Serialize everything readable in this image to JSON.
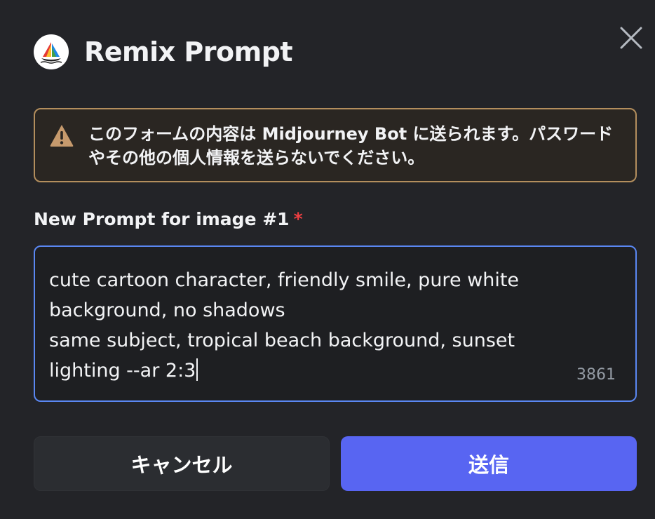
{
  "modal": {
    "title": "Remix Prompt",
    "close_icon": "close-icon",
    "avatar_icon": "midjourney-sailboat-icon"
  },
  "warning": {
    "icon": "warning-icon",
    "text": "このフォームの内容は Midjourney Bot に送られます。パスワードやその他の個人情報を送らないでください。"
  },
  "field": {
    "label": "New Prompt for image #1",
    "required_mark": "*",
    "value": "cute cartoon character, friendly smile, pure white background, no shadows\nsame subject, tropical beach background, sunset lighting --ar 2:3",
    "char_count": "3861"
  },
  "buttons": {
    "cancel_label": "キャンセル",
    "submit_label": "送信"
  },
  "colors": {
    "background": "#232428",
    "warning_border": "#b38e5d",
    "input_focus_border": "#5a87f2",
    "primary_button": "#5865f2",
    "required": "#f23f42"
  }
}
